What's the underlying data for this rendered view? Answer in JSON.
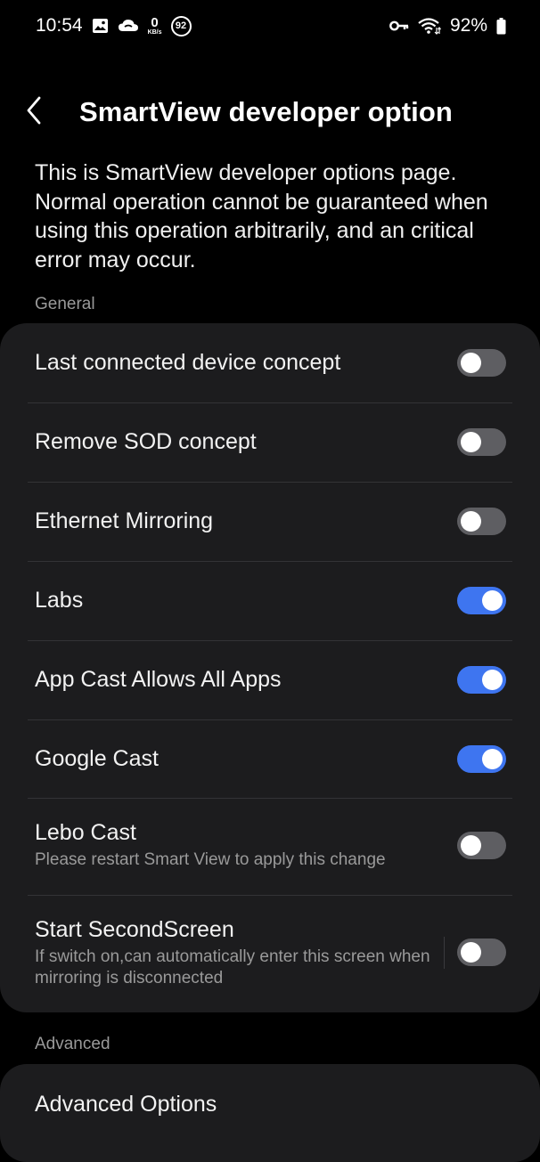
{
  "status_bar": {
    "time": "10:54",
    "net_speed_value": "0",
    "net_speed_unit": "KB/s",
    "notif_count": "92",
    "battery": "92%"
  },
  "header": {
    "title": "SmartView developer option"
  },
  "description": "This is SmartView developer options page. Normal operation cannot be guaranteed when using this operation arbitrarily, and an critical error may occur.",
  "sections": {
    "general": "General",
    "advanced": "Advanced"
  },
  "settings": [
    {
      "title": "Last connected device concept",
      "on": false
    },
    {
      "title": "Remove SOD concept",
      "on": false
    },
    {
      "title": "Ethernet Mirroring",
      "on": false
    },
    {
      "title": "Labs",
      "on": true
    },
    {
      "title": "App Cast Allows All Apps",
      "on": true
    },
    {
      "title": "Google Cast",
      "on": true
    },
    {
      "title": "Lebo Cast",
      "subtitle": "Please restart Smart View to apply this change",
      "on": false
    },
    {
      "title": "Start SecondScreen",
      "subtitle": "If switch on,can automatically enter this screen when mirroring is disconnected",
      "on": false
    }
  ],
  "advanced_options": {
    "title": "Advanced Options"
  },
  "colors": {
    "background": "#000000",
    "card": "#1c1c1e",
    "toggle_on": "#3e75f0",
    "toggle_off": "#5e5e62"
  }
}
